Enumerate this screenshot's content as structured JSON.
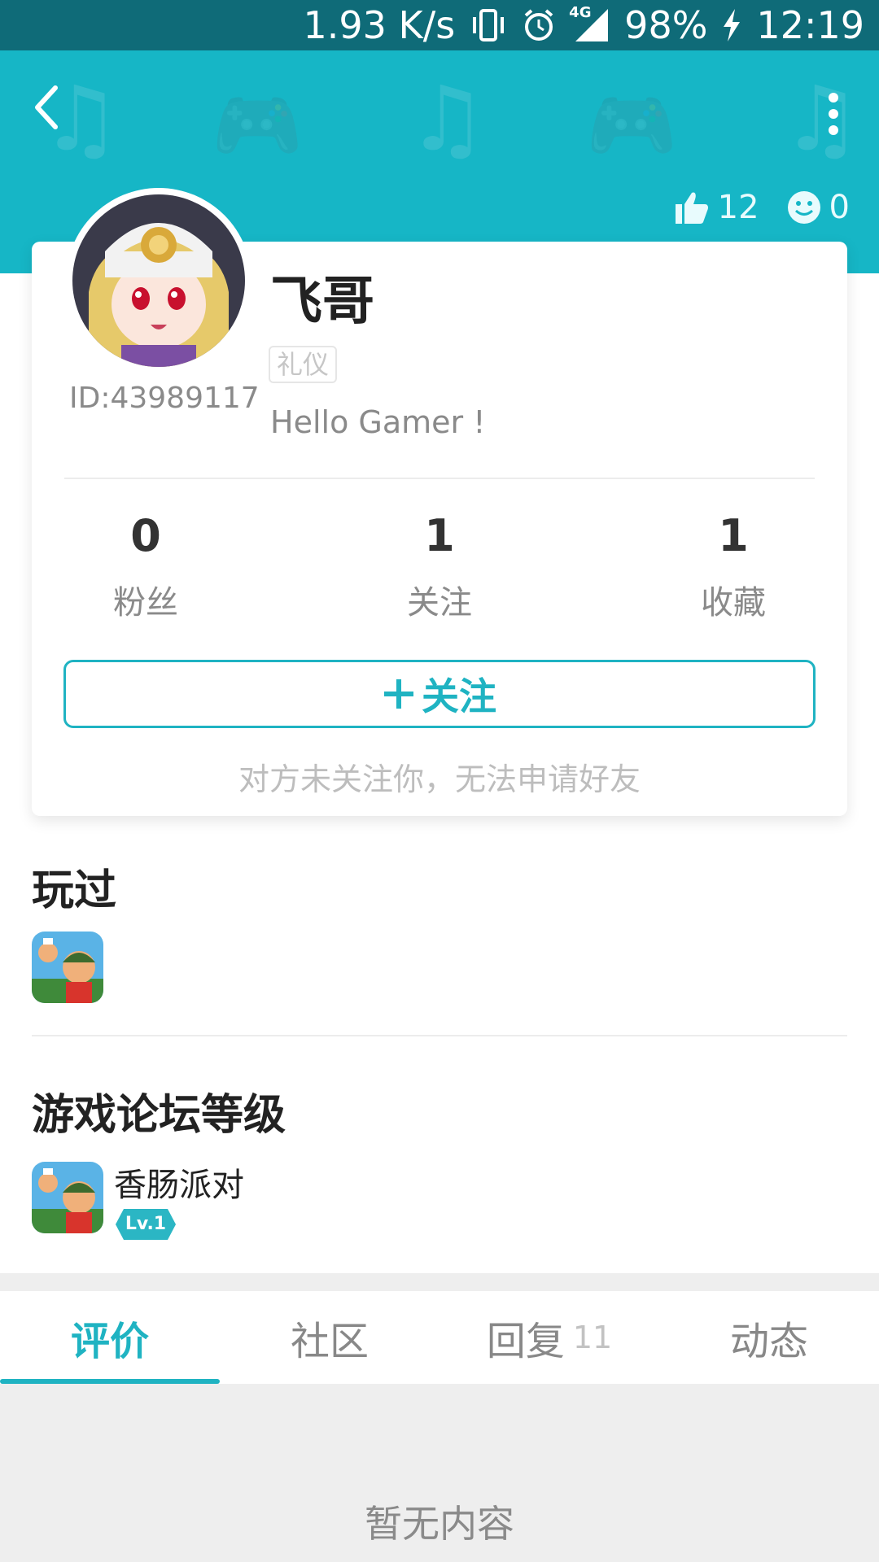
{
  "status_bar": {
    "speed": "1.93 K/s",
    "network": "4G",
    "battery": "98%",
    "time": "12:19",
    "icons": [
      "vibrate-icon",
      "alarm-icon",
      "signal-icon",
      "charging-icon"
    ]
  },
  "header": {
    "back_icon": "back-arrow-icon",
    "more_icon": "more-vertical-icon",
    "likes_count": "12",
    "smile_count": "0",
    "accent_color": "#16b6c6"
  },
  "profile": {
    "nickname": "飞哥",
    "user_id": "ID:43989117",
    "tag": "礼仪",
    "bio": "Hello Gamer !",
    "stats": [
      {
        "value": "0",
        "label": "粉丝"
      },
      {
        "value": "1",
        "label": "关注"
      },
      {
        "value": "1",
        "label": "收藏"
      }
    ],
    "follow_button_label": "关注",
    "follow_hint": "对方未关注你，无法申请好友"
  },
  "played": {
    "title": "玩过"
  },
  "forum_level": {
    "title": "游戏论坛等级",
    "game_name": "香肠派对",
    "level": "Lv.1"
  },
  "tabs": [
    {
      "label": "评价",
      "count": "",
      "active": true
    },
    {
      "label": "社区",
      "count": ""
    },
    {
      "label": "回复",
      "count": "11"
    },
    {
      "label": "动态",
      "count": ""
    }
  ],
  "empty_state": {
    "text": "暂无内容"
  }
}
